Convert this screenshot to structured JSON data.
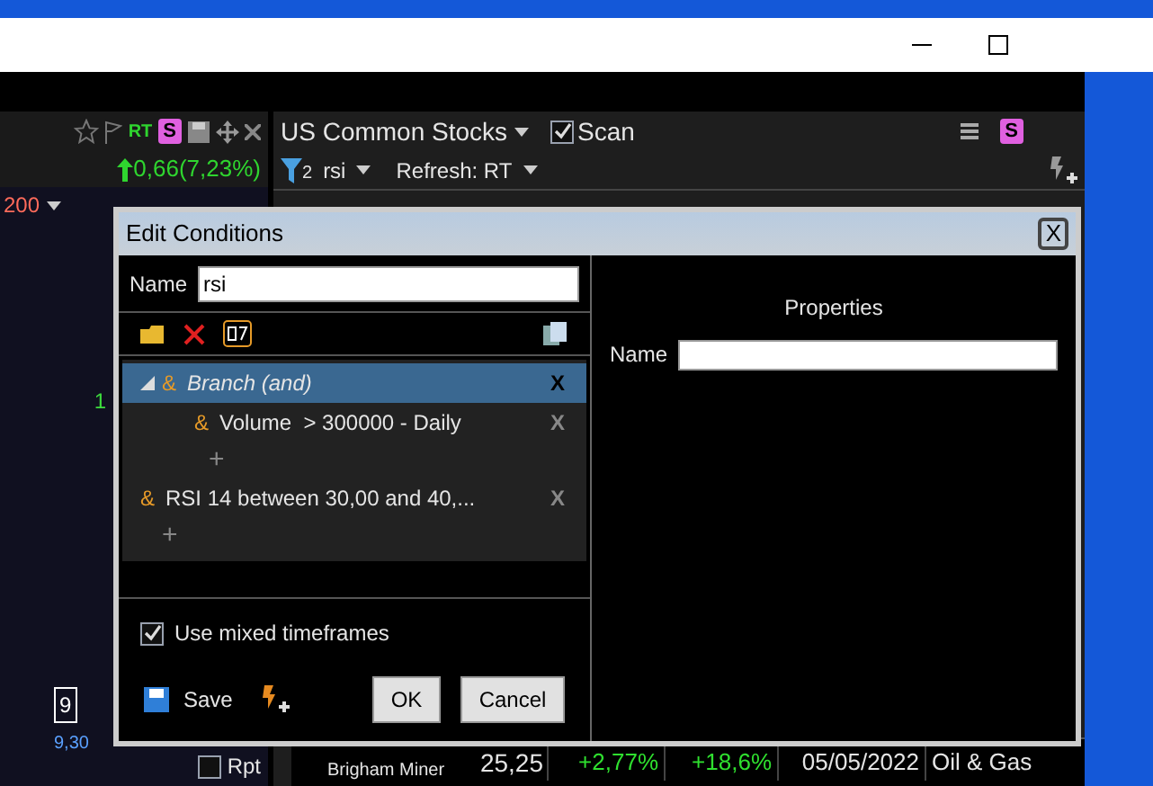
{
  "left_panel": {
    "rt_label": "RT",
    "s_badge": "S",
    "change": "0,66(7,23%)",
    "period": "200",
    "chart_labels": [
      "1",
      "9",
      "9,30"
    ],
    "rpt_label": "Rpt",
    "rpt_checked": false
  },
  "scan_panel": {
    "universe": "US Common Stocks",
    "scan_label": "Scan",
    "scan_checked": true,
    "s_badge": "S",
    "filter_count": "2",
    "filter_name": "rsi",
    "refresh": "Refresh: RT"
  },
  "table_row": {
    "company": "Brigham Miner",
    "price": "25,25",
    "change_1": "+2,77%",
    "change_2": "+18,6%",
    "date": "05/05/2022",
    "sector": "Oil & Gas"
  },
  "dialog": {
    "title": "Edit Conditions",
    "close": "X",
    "name_label": "Name",
    "name_value": "rsi",
    "conditions": [
      {
        "kind": "branch",
        "text": "Branch (and)",
        "op": "&",
        "selected": true,
        "expanded": true,
        "remove": "X",
        "children": [
          {
            "kind": "condition",
            "text": "Volume  > 300000 - Daily",
            "op": "&",
            "selected": false,
            "remove": "X"
          }
        ],
        "add": "+"
      },
      {
        "kind": "condition",
        "text": "RSI 14 between 30,00 and 40,...",
        "op": "&",
        "selected": false,
        "remove": "X"
      }
    ],
    "add": "+",
    "mixed_label": "Use mixed timeframes",
    "mixed_checked": true,
    "save": "Save",
    "ok": "OK",
    "cancel": "Cancel",
    "properties": {
      "title": "Properties",
      "name_label": "Name"
    }
  }
}
